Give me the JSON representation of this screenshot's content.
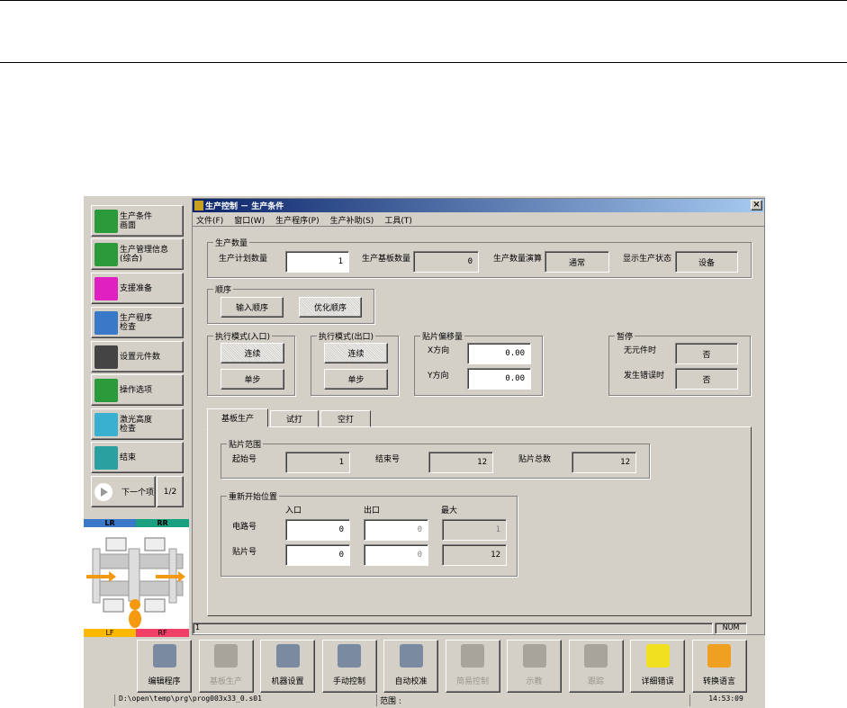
{
  "window": {
    "title": "生产控制 － 生产条件",
    "close": "×"
  },
  "menu": [
    "文件(F)",
    "窗口(W)",
    "生产程序(P)",
    "生产补助(S)",
    "工具(T)"
  ],
  "sidebar": [
    {
      "label": "生产条件\n画面",
      "icon": "production-condition-icon"
    },
    {
      "label": "生产管理信息\n(综合)",
      "icon": "management-info-icon"
    },
    {
      "label": "支援准备",
      "icon": "support-prep-icon"
    },
    {
      "label": "生产程序\n检查",
      "icon": "program-check-icon"
    },
    {
      "label": "设置元件数",
      "icon": "set-parts-icon"
    },
    {
      "label": "操作选项",
      "icon": "operation-option-icon"
    },
    {
      "label": "激光高度\n检查",
      "icon": "laser-height-icon"
    },
    {
      "label": "结束",
      "icon": "exit-door-icon"
    }
  ],
  "next": {
    "label": "下一个项",
    "page": "1/2"
  },
  "heads": {
    "lr": "LR",
    "rr": "RR",
    "lf": "LF",
    "rf": "RF",
    "colors": {
      "lr": "#3a78c8",
      "rr": "#18a080",
      "lf": "#ffb800",
      "rf": "#f04068"
    }
  },
  "qty": {
    "title": "生产数量",
    "plan_label": "生产计划数量",
    "plan_value": "1",
    "board_label": "生产基板数量",
    "board_value": "0",
    "calc_label": "生产数量演算",
    "calc_value": "通常",
    "status_label": "显示生产状态",
    "status_value": "设备"
  },
  "order": {
    "title": "顺序",
    "input": "输入顺序",
    "optimize": "优化顺序"
  },
  "mode_in": {
    "title": "执行模式(入口)",
    "continuous": "连续",
    "step": "单步"
  },
  "mode_out": {
    "title": "执行模式(出口)",
    "continuous": "连续",
    "step": "单步"
  },
  "offset": {
    "title": "贴片偏移量",
    "x_label": "X方向",
    "x_value": "0.00",
    "y_label": "Y方向",
    "y_value": "0.00"
  },
  "pause": {
    "title": "暂停",
    "no_part_label": "无元件时",
    "no_part_value": "否",
    "error_label": "发生错误时",
    "error_value": "否"
  },
  "tabs": [
    "基板生产",
    "试打",
    "空打"
  ],
  "range": {
    "title": "贴片范围",
    "start_label": "起始号",
    "start_value": "1",
    "end_label": "结束号",
    "end_value": "12",
    "total_label": "贴片总数",
    "total_value": "12"
  },
  "restart": {
    "title": "重新开始位置",
    "col_in": "入口",
    "col_out": "出口",
    "col_max": "最大",
    "circuit_label": "电路号",
    "circuit_in": "0",
    "circuit_out": "0",
    "circuit_max": "1",
    "mount_label": "贴片号",
    "mount_in": "0",
    "mount_out": "0",
    "mount_max": "12"
  },
  "statusbar": {
    "left": "1",
    "num": "NUM"
  },
  "toolbar": [
    {
      "label": "编辑程序",
      "enabled": true
    },
    {
      "label": "基板生产",
      "enabled": false
    },
    {
      "label": "机器设置",
      "enabled": true
    },
    {
      "label": "手动控制",
      "enabled": true
    },
    {
      "label": "自动校准",
      "enabled": true
    },
    {
      "label": "简易控制",
      "enabled": false
    },
    {
      "label": "示教",
      "enabled": false
    },
    {
      "label": "跟踪",
      "enabled": false
    },
    {
      "label": "详细错误",
      "enabled": true
    },
    {
      "label": "转换语言",
      "enabled": true
    }
  ],
  "footer": {
    "path": "D:\\open\\temp\\prg\\prog003x33_0.s01",
    "range_label": "范围 :",
    "time": "14:53:09"
  }
}
